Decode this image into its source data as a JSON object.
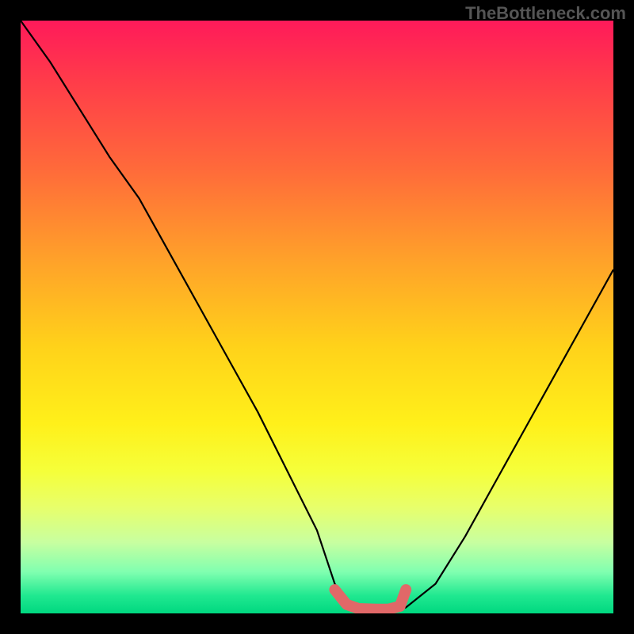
{
  "watermark": "TheBottleneck.com",
  "chart_data": {
    "type": "line",
    "title": "",
    "xlabel": "",
    "ylabel": "",
    "xlim": [
      0,
      100
    ],
    "ylim": [
      0,
      100
    ],
    "series": [
      {
        "name": "bottleneck-curve",
        "x": [
          0,
          5,
          10,
          15,
          20,
          25,
          30,
          35,
          40,
          45,
          50,
          53,
          56,
          60,
          62,
          65,
          70,
          75,
          80,
          85,
          90,
          95,
          100
        ],
        "y": [
          100,
          93,
          85,
          77,
          70,
          61,
          52,
          43,
          34,
          24,
          14,
          5,
          1,
          0,
          0,
          1,
          5,
          13,
          22,
          31,
          40,
          49,
          58
        ]
      },
      {
        "name": "optimal-zone-marker",
        "x": [
          53,
          55,
          57,
          60,
          62,
          64,
          65
        ],
        "y": [
          4,
          1.5,
          0.8,
          0.7,
          0.7,
          1.2,
          4
        ]
      }
    ],
    "gradient_stops": [
      {
        "pos": 0,
        "color": "#ff1a5a"
      },
      {
        "pos": 25,
        "color": "#ff6a3a"
      },
      {
        "pos": 55,
        "color": "#ffd21a"
      },
      {
        "pos": 82,
        "color": "#e8ff6a"
      },
      {
        "pos": 100,
        "color": "#00d880"
      }
    ]
  }
}
